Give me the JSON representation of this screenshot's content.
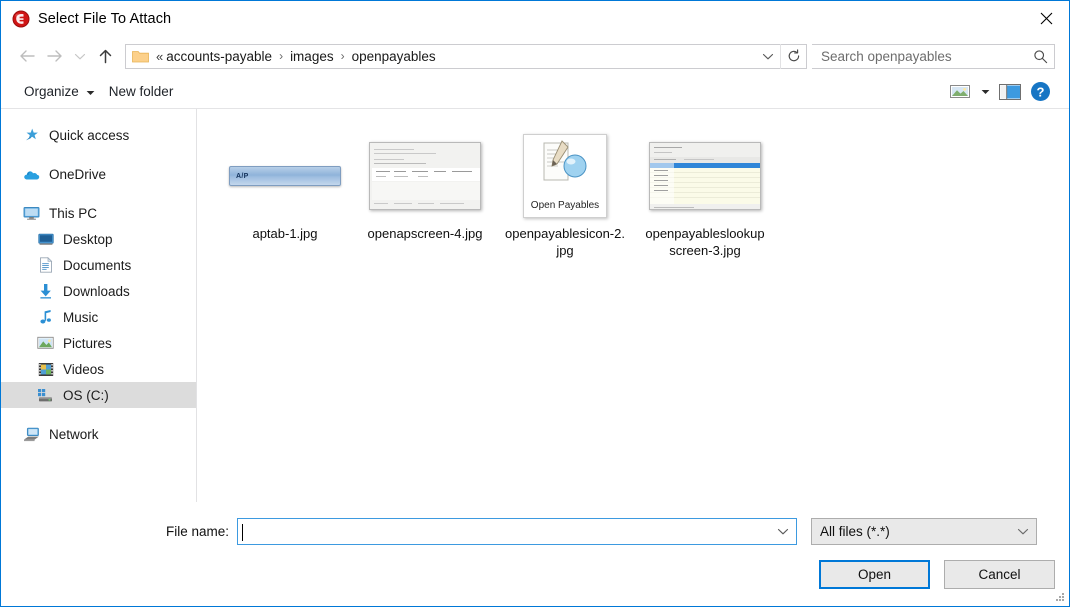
{
  "window": {
    "title": "Select File To Attach",
    "app_icon": "app-logo-icon",
    "close_label": "✕",
    "border_color": "#0078d7"
  },
  "nav": {
    "back": "back-arrow",
    "forward": "forward-arrow",
    "recent": "recent-locations-chevron",
    "up": "up-arrow",
    "breadcrumb": {
      "ellipsis": "«",
      "separator": "›",
      "items": [
        "accounts-payable",
        "images",
        "openpayables"
      ]
    },
    "refresh": "refresh-icon",
    "address_dropdown": "chevron-down-icon"
  },
  "search": {
    "placeholder": "Search openpayables",
    "value": "",
    "icon": "search-icon"
  },
  "toolbar": {
    "organize_label": "Organize",
    "organize_caret": "▼",
    "new_folder_label": "New folder",
    "view_icon": "view-options-icon",
    "view_caret": "▼",
    "preview_pane_icon": "preview-pane-icon",
    "help_icon": "help-icon",
    "help_glyph": "?"
  },
  "sidebar": {
    "items": [
      {
        "label": "Quick access",
        "icon": "star-icon",
        "indent": false,
        "selected": false,
        "gap_before": false
      },
      {
        "label": "OneDrive",
        "icon": "cloud-icon",
        "indent": false,
        "selected": false,
        "gap_before": true
      },
      {
        "label": "This PC",
        "icon": "monitor-icon",
        "indent": false,
        "selected": false,
        "gap_before": true
      },
      {
        "label": "Desktop",
        "icon": "desktop-icon",
        "indent": true,
        "selected": false,
        "gap_before": false
      },
      {
        "label": "Documents",
        "icon": "documents-icon",
        "indent": true,
        "selected": false,
        "gap_before": false
      },
      {
        "label": "Downloads",
        "icon": "downloads-icon",
        "indent": true,
        "selected": false,
        "gap_before": false
      },
      {
        "label": "Music",
        "icon": "music-icon",
        "indent": true,
        "selected": false,
        "gap_before": false
      },
      {
        "label": "Pictures",
        "icon": "pictures-icon",
        "indent": true,
        "selected": false,
        "gap_before": false
      },
      {
        "label": "Videos",
        "icon": "videos-icon",
        "indent": true,
        "selected": false,
        "gap_before": false
      },
      {
        "label": "OS (C:)",
        "icon": "drive-icon",
        "indent": true,
        "selected": true,
        "gap_before": false
      },
      {
        "label": "Network",
        "icon": "network-icon",
        "indent": false,
        "selected": false,
        "gap_before": true
      }
    ],
    "selected_background": "#dcdcdc"
  },
  "files": [
    {
      "name": "aptab-1.jpg",
      "thumb": "ap-tab-thumbnail",
      "thumb_caption": "A/P"
    },
    {
      "name": "openapscreen-4.jpg",
      "thumb": "screenshot-thumbnail",
      "thumb_caption": ""
    },
    {
      "name": "openpayablesicon-2.jpg",
      "thumb": "open-payables-icon-thumbnail",
      "thumb_caption": "Open Payables"
    },
    {
      "name": "openpayableslookupscreen-3.jpg",
      "thumb": "grid-screenshot-thumbnail",
      "thumb_caption": ""
    }
  ],
  "footer": {
    "filename_label": "File name:",
    "filename_value": "",
    "filename_placeholder": "",
    "filename_dropdown": "chevron-down-icon",
    "filetype_value": "All files (*.*)",
    "filetype_dropdown": "chevron-down-icon",
    "open_label": "Open",
    "cancel_label": "Cancel",
    "resize_grip": "resize-grip-icon"
  }
}
